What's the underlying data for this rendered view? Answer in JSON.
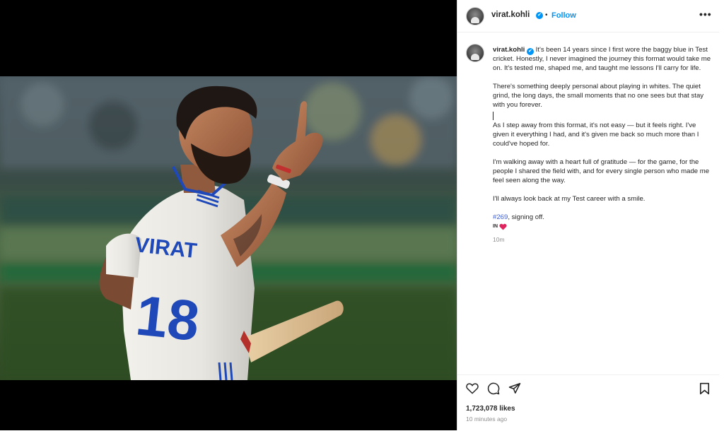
{
  "post": {
    "username": "virat.kohli",
    "verified_mark": "✔",
    "dot": "•",
    "follow_label": "Follow",
    "more_label": "•••",
    "caption": {
      "p1": "It's been 14 years since I first wore the baggy blue in Test cricket. Honestly, I never imagined the journey this format would take me on. It's tested me, shaped me, and taught me lessons I'll carry for life.",
      "p2": "There's something deeply personal about playing in whites. The quiet grind, the long days, the small moments that no one sees but that stay with you forever.",
      "p3": "As I step away from this format, it's not easy — but it feels right. I've given it everything I had, and it's given me back so much more than I could've hoped for.",
      "p4": "I'm walking away with a heart full of gratitude — for the game, for the people I shared the field with, and for every single person who made me feel seen along the way.",
      "p5": "I'll always look back at my Test career with a smile.",
      "hashtag": "#269",
      "signoff": ", signing off.",
      "flag_text": "IN",
      "age": "10m"
    },
    "likes": "1,723,078 likes",
    "time_ago": "10 minutes ago",
    "jersey_name": "VIRAT",
    "jersey_number": "18",
    "colors": {
      "accent": "#0095f6",
      "heart": "#e0245e",
      "jersey_blue": "#1f48b8"
    },
    "icons": {
      "like": "heart-outline-icon",
      "comment": "comment-bubble-icon",
      "share": "paper-plane-icon",
      "save": "bookmark-icon"
    }
  }
}
